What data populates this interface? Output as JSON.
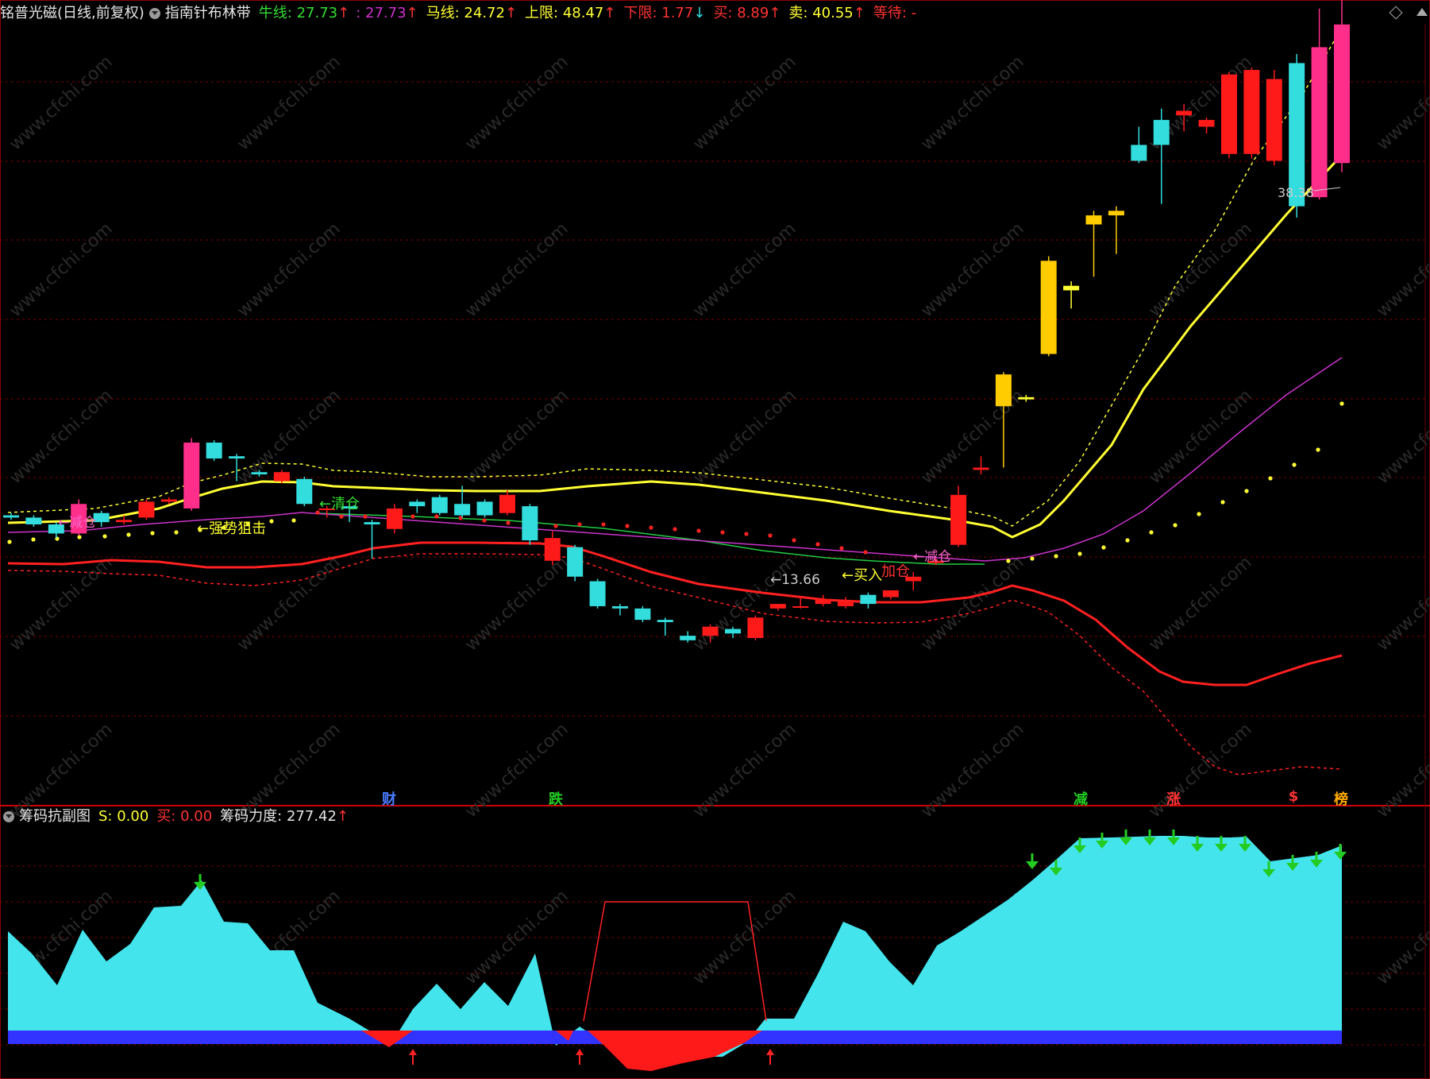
{
  "main_header": {
    "stock": "铭普光磁(日线,前复权)",
    "indicator": "指南针布林带",
    "bull_label": "牛线: 27.73",
    "purple_val": ": 27.73",
    "horse_label": "马线: 24.72",
    "upper_label": "上限: 48.47",
    "lower_label": "下限: 1.77",
    "buy_label": "买: 8.89",
    "sell_label": "卖: 40.55",
    "wait_label": "等待: -",
    "up_arrow": "↑",
    "down_arrow": "↓"
  },
  "sub_header": {
    "name": "筹码抗副图",
    "s_label": "S: 0.00",
    "buy_label": "买: 0.00",
    "power_label": "筹码力度: 277.42",
    "up_arrow": "↑"
  },
  "annotations": {
    "reduce1": "←减仓",
    "strong": "←强势狙击",
    "clear": "←清仓",
    "low_price": "←13.66",
    "buy_in": "←买入",
    "add": "加仓",
    "reduce2": "←减仓",
    "high_price": "38.38"
  },
  "bottom_signals": [
    {
      "text": "财",
      "color": "#4a7cff"
    },
    {
      "text": "跌",
      "color": "#22cc22"
    },
    {
      "text": "减",
      "color": "#22cc22"
    },
    {
      "text": "涨",
      "color": "#ff3333"
    },
    {
      "text": "$",
      "color": "#ff3333"
    },
    {
      "text": "榜",
      "color": "#ffaa00"
    }
  ],
  "watermark": "www.cfchi.com",
  "colors": {
    "bull": "#ffff33",
    "purple": "#cc33cc",
    "horse": "#22cc44",
    "lower": "#ff2020",
    "up_candle": "#ff1a1a",
    "down_candle": "#33dddd",
    "area": "#44e4ec",
    "base": "#3333ff"
  },
  "chart_data": {
    "type": "candlestick",
    "candles": [
      [
        20.9,
        21.0,
        20.7,
        20.8
      ],
      [
        20.8,
        20.9,
        20.4,
        20.5
      ],
      [
        20.5,
        20.6,
        19.9,
        20.1
      ],
      [
        20.1,
        21.6,
        20.0,
        21.4
      ],
      [
        21.0,
        21.1,
        20.4,
        20.6
      ],
      [
        20.6,
        20.9,
        20.5,
        20.7
      ],
      [
        20.8,
        21.6,
        20.7,
        21.5
      ],
      [
        21.5,
        21.7,
        21.4,
        21.6
      ],
      [
        21.2,
        24.3,
        21.1,
        24.1
      ],
      [
        24.1,
        24.2,
        23.3,
        23.4
      ],
      [
        23.5,
        23.6,
        22.4,
        23.4
      ],
      [
        22.8,
        22.9,
        22.6,
        22.7
      ],
      [
        22.4,
        22.9,
        22.3,
        22.8
      ],
      [
        22.5,
        22.6,
        21.3,
        21.4
      ],
      [
        21.2,
        21.3,
        20.8,
        21.2
      ],
      [
        21.3,
        21.4,
        20.6,
        21.2
      ],
      [
        20.6,
        20.7,
        19.0,
        20.5
      ],
      [
        20.3,
        21.4,
        20.1,
        21.2
      ],
      [
        21.5,
        21.6,
        21.0,
        21.3
      ],
      [
        21.7,
        21.8,
        20.9,
        21.0
      ],
      [
        21.4,
        22.2,
        20.8,
        20.9
      ],
      [
        21.5,
        21.6,
        20.8,
        20.9
      ],
      [
        21.0,
        22.0,
        20.9,
        21.8
      ],
      [
        21.3,
        21.4,
        19.6,
        19.8
      ],
      [
        18.9,
        20.2,
        18.7,
        19.9
      ],
      [
        19.5,
        19.6,
        18.0,
        18.2
      ],
      [
        18.0,
        18.1,
        16.8,
        16.9
      ],
      [
        16.9,
        17.0,
        16.5,
        16.8
      ],
      [
        16.8,
        16.9,
        16.2,
        16.3
      ],
      [
        16.3,
        16.4,
        15.6,
        16.2
      ],
      [
        15.6,
        15.8,
        15.3,
        15.4
      ],
      [
        15.6,
        16.1,
        15.3,
        16.0
      ],
      [
        15.9,
        16.0,
        15.5,
        15.7
      ],
      [
        15.5,
        16.5,
        15.4,
        16.4
      ],
      [
        16.8,
        17.0,
        16.7,
        17.0
      ],
      [
        16.9,
        17.3,
        16.8,
        16.9
      ],
      [
        17.0,
        17.4,
        16.9,
        17.2
      ],
      [
        16.9,
        17.3,
        16.8,
        17.1
      ],
      [
        17.4,
        17.5,
        16.8,
        17.0
      ],
      [
        17.3,
        17.6,
        17.2,
        17.6
      ],
      [
        18.0,
        18.4,
        17.6,
        18.2
      ],
      [
        18.8,
        19.0,
        18.7,
        18.9
      ],
      [
        19.6,
        22.2,
        19.5,
        21.8
      ],
      [
        22.9,
        23.5,
        22.7,
        23.0
      ],
      [
        25.7,
        27.2,
        23.0,
        27.1
      ],
      [
        26.0,
        26.2,
        25.9,
        26.1
      ],
      [
        28.0,
        32.3,
        27.9,
        32.1
      ],
      [
        30.8,
        31.2,
        30.0,
        31.0
      ],
      [
        33.7,
        34.3,
        31.4,
        34.1
      ],
      [
        34.1,
        34.5,
        32.4,
        34.3
      ],
      [
        37.2,
        38.0,
        36.4,
        36.5
      ],
      [
        38.3,
        38.8,
        34.6,
        37.2
      ],
      [
        38.5,
        39.0,
        37.8,
        38.7
      ],
      [
        38.0,
        38.4,
        37.7,
        38.3
      ],
      [
        36.8,
        40.4,
        36.6,
        40.3
      ],
      [
        36.8,
        40.6,
        36.6,
        40.5
      ],
      [
        36.5,
        40.5,
        36.3,
        40.1
      ],
      [
        40.8,
        41.2,
        34.0,
        34.5
      ],
      [
        41.5,
        43.2,
        34.8,
        34.9
      ],
      [
        42.5,
        43.9,
        36.0,
        36.4
      ]
    ],
    "notes": "candles are [open,high,low,close] approximate in price units; only the visible rendering matters"
  }
}
